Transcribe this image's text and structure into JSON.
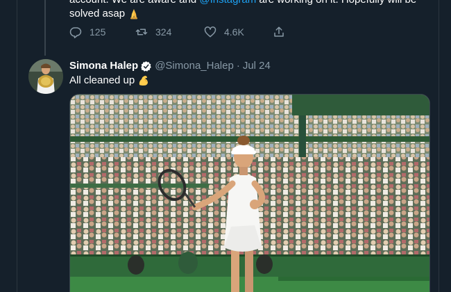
{
  "previous_tweet": {
    "text_before_mention": "account. We are aware and ",
    "mention": "@Instagram",
    "text_after_mention": " are working on it. Hopefully will be",
    "text_line2": "solved asap",
    "emoji": "folded-hands-emoji",
    "reply_count": "125",
    "retweet_count": "324",
    "like_count": "4.6K"
  },
  "tweet": {
    "display_name": "Simona Halep",
    "handle": "@Simona_Halep",
    "separator": "·",
    "date": "Jul 24",
    "text": "All cleaned up",
    "emoji": "flexed-biceps-emoji"
  },
  "icons": {
    "reply": "reply-icon",
    "retweet": "retweet-icon",
    "like": "like-icon",
    "share": "share-icon",
    "verified": "verified-badge-icon"
  },
  "colors": {
    "background": "#15202b",
    "accent": "#1da1f2",
    "secondary_text": "#8899a6",
    "court_green": "#2f7a3d"
  }
}
